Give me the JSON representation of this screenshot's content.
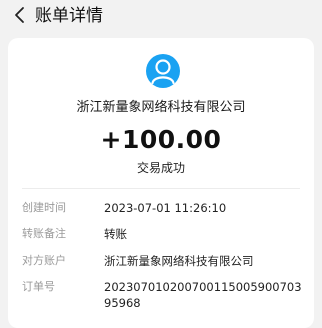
{
  "header": {
    "title": "账单详情",
    "back_icon": "chevron-left-icon"
  },
  "bill": {
    "avatar_icon": "user-avatar-icon",
    "avatar_color": "#1aa2f2",
    "payee": "浙江新量象网络科技有限公司",
    "amount": "+100.00",
    "status": "交易成功"
  },
  "details": [
    {
      "label": "创建时间",
      "value": "2023-07-01 11:26:10"
    },
    {
      "label": "转账备注",
      "value": "转账"
    },
    {
      "label": "对方账户",
      "value": "浙江新量象网络科技有限公司"
    },
    {
      "label": "订单号",
      "value": "20230701020070011500590070395968"
    }
  ]
}
